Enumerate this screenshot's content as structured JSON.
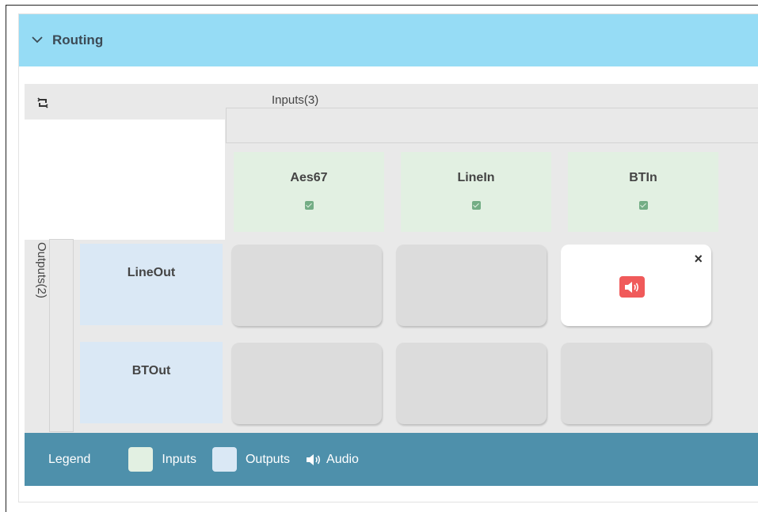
{
  "section": {
    "title": "Routing",
    "expanded": true,
    "header_color": "#96dcf5"
  },
  "matrix": {
    "inputs_label": "Inputs(3)",
    "outputs_label": "Outputs(2)",
    "inputs": [
      {
        "name": "Aes67",
        "checked": true
      },
      {
        "name": "LineIn",
        "checked": true
      },
      {
        "name": "BTIn",
        "checked": true
      }
    ],
    "outputs": [
      {
        "name": "LineOut"
      },
      {
        "name": "BTOut"
      }
    ],
    "routes": [
      [
        false,
        false,
        true
      ],
      [
        false,
        false,
        false
      ]
    ],
    "route_icon": "speaker-audio-icon",
    "remove_icon": "close-icon",
    "remove_glyph": "×"
  },
  "legend": {
    "title": "Legend",
    "items": [
      {
        "label": "Inputs",
        "color": "#e2f0e2"
      },
      {
        "label": "Outputs",
        "color": "#dae8f5"
      },
      {
        "label": "Audio",
        "icon": "speaker-icon"
      }
    ],
    "background": "#4e90ab"
  },
  "colors": {
    "active_route_badge": "#f05a5a",
    "checkbox": "#73ad85"
  }
}
